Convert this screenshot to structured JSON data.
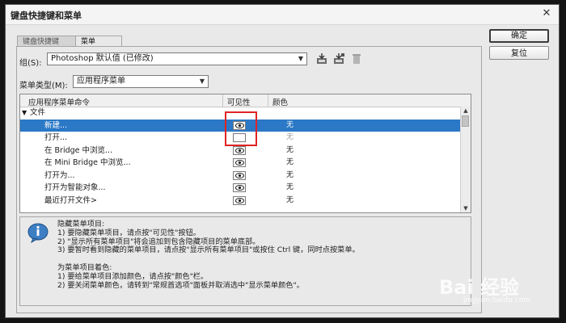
{
  "window": {
    "title": "键盘快捷键和菜单",
    "close_glyph": "✕"
  },
  "buttons": {
    "ok": "确定",
    "reset": "复位"
  },
  "tabs": [
    {
      "label": "键盘快捷键",
      "active": false
    },
    {
      "label": "菜单",
      "active": true
    }
  ],
  "group": {
    "label": "组(S):",
    "value": "Photoshop 默认值 (已修改)",
    "icons": [
      "save-set-icon",
      "save-as-set-icon",
      "delete-set-icon"
    ]
  },
  "menu_type": {
    "label": "菜单类型(M):",
    "value": "应用程序菜单"
  },
  "table": {
    "headers": {
      "command": "应用程序菜单命令",
      "visibility": "可见性",
      "color": "颜色"
    },
    "rows": [
      {
        "name": "文件",
        "group": true
      },
      {
        "name": "新建...",
        "visible": true,
        "color": "无",
        "selected": true
      },
      {
        "name": "打开...",
        "visible": false,
        "color": "无"
      },
      {
        "name": "在 Bridge 中浏览...",
        "visible": true,
        "color": "无"
      },
      {
        "name": "在 Mini Bridge 中浏览...",
        "visible": true,
        "color": "无"
      },
      {
        "name": "打开为...",
        "visible": true,
        "color": "无"
      },
      {
        "name": "打开为智能对象...",
        "visible": true,
        "color": "无"
      },
      {
        "name": "最近打开文件>",
        "visible": true,
        "color": "无"
      }
    ]
  },
  "info": {
    "lines": [
      "隐藏菜单项目:",
      "1) 要隐藏菜单项目，请点按\"可见性\"按钮。",
      "2) \"显示所有菜单项目\"将会追加到包含隐藏项目的菜单底部。",
      "3) 要暂时看到隐藏的菜单项目，请点按\"显示所有菜单项目\"或按住 Ctrl 键，同时点按菜单。",
      "",
      "为菜单项目着色:",
      "1) 要给菜单项目添加颜色，请点按\"颜色\"栏。",
      "2) 要关闭菜单颜色，请转到\"常规首选项\"面板并取消选中\"显示菜单颜色\"。"
    ]
  },
  "watermark": {
    "main": "Bai 经验",
    "sub": "jingyan.baidu.com"
  },
  "colors": {
    "selection": "#2a78c6",
    "highlight_box": "#e02424"
  }
}
